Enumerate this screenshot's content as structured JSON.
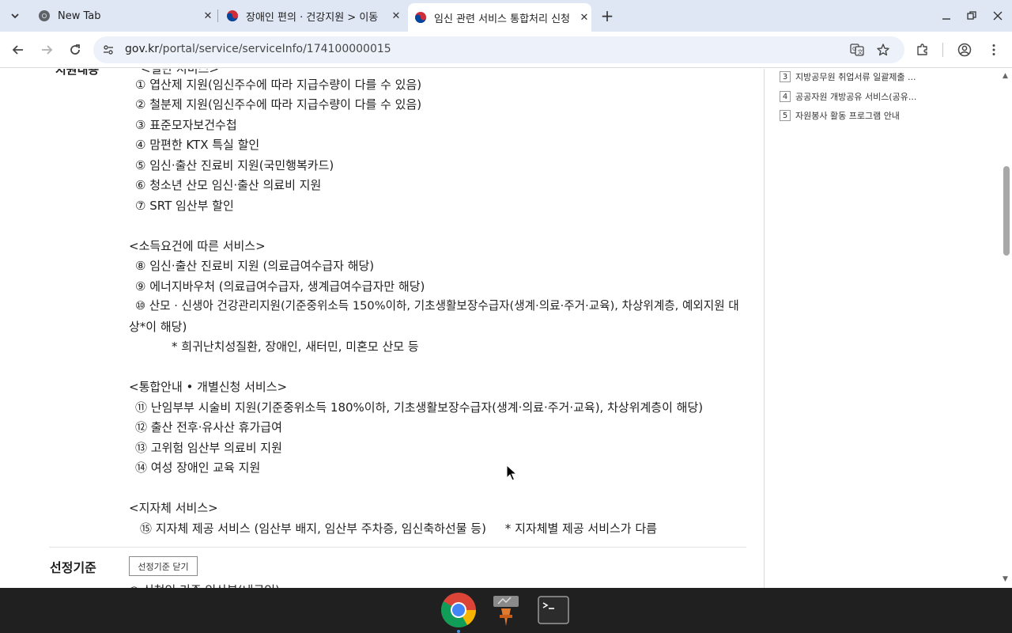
{
  "tabs": [
    {
      "title": "New Tab",
      "icon": "chrome-icon"
    },
    {
      "title": "장애인 편의 · 건강지원 > 이동",
      "icon": "gov-taegeuk-icon"
    },
    {
      "title": "임신 관련 서비스 통합처리 신청",
      "icon": "gov-taegeuk-icon",
      "active": true
    }
  ],
  "address": {
    "domain": "gov.kr",
    "path": "/portal/service/serviceInfo/174100000015"
  },
  "content": {
    "top_label_cut": "지원내용",
    "top_line_cut": "<일반 서비스>",
    "lines": [
      "① 엽산제 지원(임신주수에 따라 지급수량이 다를 수 있음)",
      "② 철분제 지원(임신주수에 따라 지급수량이 다를 수 있음)",
      "③ 표준모자보건수첩",
      "④ 맘편한 KTX 특실 할인",
      "⑤ 임신·출산 진료비 지원(국민행복카드)",
      "⑥ 청소년 산모 임신·출산 의료비 지원",
      "⑦ SRT 임산부 할인",
      "<소득요건에 따른 서비스>",
      "⑧ 임신·출산 진료비 지원 (의료급여수급자 해당)",
      "⑨ 에너지바우처 (의료급여수급자, 생계급여수급자만 해당)",
      "⑩ 산모 · 신생아 건강관리지원(기준중위소득 150%이하, 기초생활보장수급자(생계·의료·주거·교육), 차상위계층, 예외지원 대",
      "상*이 해당)",
      "* 희귀난치성질환, 장애인, 새터민, 미혼모 산모 등",
      "<통합안내 • 개별신청 서비스>",
      "⑪ 난임부부 시술비 지원(기준중위소득 180%이하, 기초생활보장수급자(생계·의료·주거·교육), 차상위계층이 해당)",
      "⑫ 출산 전후·유사산 휴가급여",
      "⑬ 고위험 임산부 의료비 지원",
      "⑭ 여성 장애인 교육 지원",
      "<지자체 서비스>",
      "⑮ 지자체 제공 서비스 (임산부 배지, 임산부 주차증, 임신축하선물 등)     * 지자체별 제공 서비스가 다름"
    ],
    "selection_label": "선정기준",
    "selection_button": "선정기준 닫기",
    "bottom_line_cut": "○ 신청인 기준 임산부(내국인)"
  },
  "sidebar": {
    "items": [
      {
        "num": "3",
        "text": "지방공무원 취업서류 일괄제출 ..."
      },
      {
        "num": "4",
        "text": "공공자원 개방공유 서비스(공유..."
      },
      {
        "num": "5",
        "text": "자원봉사 활동 프로그램 안내"
      }
    ]
  },
  "taskbar": {
    "apps": [
      "chrome-icon",
      "file-manager-icon",
      "terminal-icon"
    ]
  },
  "colors": {
    "tabstrip": "#dfe6f4",
    "omnibox": "#edf2fa",
    "taskbar": "#202020"
  }
}
